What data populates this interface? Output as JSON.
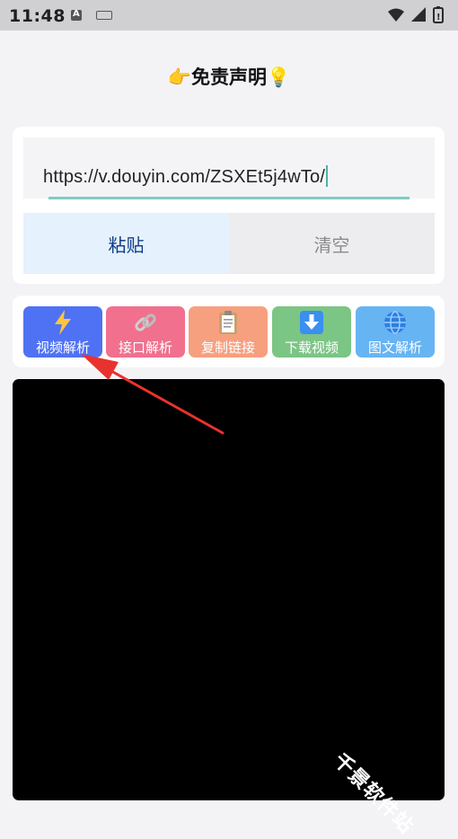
{
  "status_bar": {
    "time": "11:48"
  },
  "header": {
    "title": "👉免责声明💡"
  },
  "input": {
    "value": "https://v.douyin.com/ZSXEt5j4wTo/"
  },
  "buttons": {
    "paste": "粘贴",
    "clear": "清空"
  },
  "functions": [
    {
      "label": "视频解析",
      "icon": "lightning-icon",
      "color": "#4f72f4"
    },
    {
      "label": "接口解析",
      "icon": "link-icon",
      "color": "#f0708e"
    },
    {
      "label": "复制链接",
      "icon": "clipboard-icon",
      "color": "#f6a07f"
    },
    {
      "label": "下载视频",
      "icon": "download-icon",
      "color": "#7bc585"
    },
    {
      "label": "图文解析",
      "icon": "globe-icon",
      "color": "#67b4f3"
    }
  ],
  "watermark": "千景软件站"
}
